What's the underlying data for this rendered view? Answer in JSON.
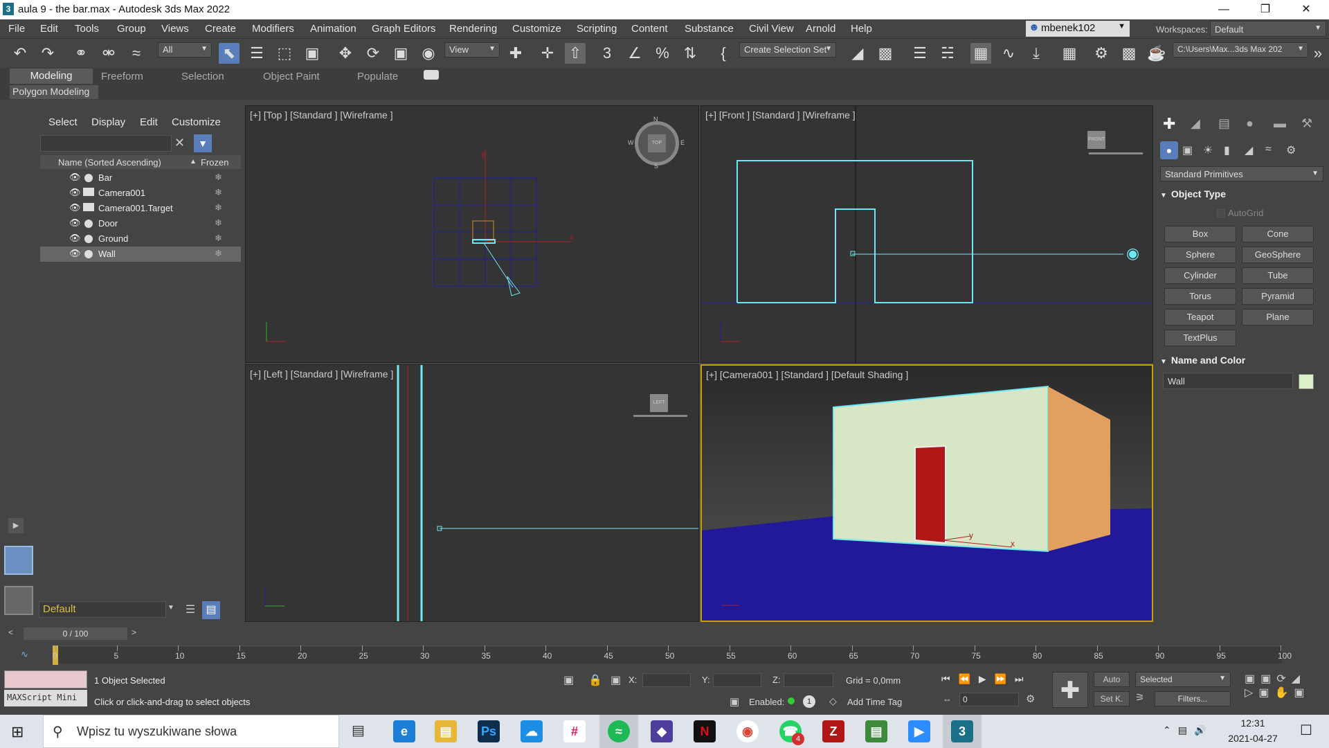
{
  "window": {
    "title": "aula 9 - the bar.max - Autodesk 3ds Max 2022",
    "app_icon": "3"
  },
  "menu": [
    "File",
    "Edit",
    "Tools",
    "Group",
    "Views",
    "Create",
    "Modifiers",
    "Animation",
    "Graph Editors",
    "Rendering",
    "Customize",
    "Scripting",
    "Content",
    "Substance",
    "Civil View",
    "Arnold",
    "Help"
  ],
  "user": "mbenek102",
  "workspace": {
    "label": "Workspaces:",
    "value": "Default"
  },
  "toolbar": {
    "filter_value": "All",
    "ref_coord_value": "View",
    "selection_set": "Create Selection Set",
    "project_path": "C:\\Users\\Max...3ds Max 202"
  },
  "ribbon": {
    "tabs": [
      "Modeling",
      "Freeform",
      "Selection",
      "Object Paint",
      "Populate"
    ],
    "panel": "Polygon Modeling"
  },
  "scene_explorer": {
    "menu": [
      "Select",
      "Display",
      "Edit",
      "Customize"
    ],
    "col_name": "Name (Sorted Ascending)",
    "col_sort": "▲",
    "col_frozen": "Frozen",
    "items": [
      {
        "name": "Bar",
        "type": "geometry"
      },
      {
        "name": "Camera001",
        "type": "camera"
      },
      {
        "name": "Camera001.Target",
        "type": "camera"
      },
      {
        "name": "Door",
        "type": "geometry"
      },
      {
        "name": "Ground",
        "type": "geometry"
      },
      {
        "name": "Wall",
        "type": "geometry",
        "selected": true
      }
    ],
    "layer": "Default"
  },
  "viewports": {
    "top": "[+] [Top ] [Standard ] [Wireframe ]",
    "front": "[+] [Front ] [Standard ] [Wireframe ]",
    "left": "[+] [Left ] [Standard ] [Wireframe ]",
    "camera": "[+] [Camera001 ] [Standard ] [Default Shading ]",
    "compass": {
      "n": "N",
      "s": "S",
      "e": "E",
      "w": "W",
      "cube": "TOP"
    },
    "front_cube": "FRONT",
    "left_cube": "LEFT",
    "axis": {
      "x": "x",
      "y": "y",
      "z": "z"
    }
  },
  "command_panel": {
    "category": "Standard Primitives",
    "object_type_title": "Object Type",
    "autogrid": "AutoGrid",
    "primitives": [
      "Box",
      "Cone",
      "Sphere",
      "GeoSphere",
      "Cylinder",
      "Tube",
      "Torus",
      "Pyramid",
      "Teapot",
      "Plane",
      "TextPlus"
    ],
    "name_color_title": "Name and Color",
    "object_name": "Wall",
    "object_color": "#d9f0c8"
  },
  "timeline": {
    "frame_display": "0 / 100",
    "ticks": [
      "0",
      "5",
      "10",
      "15",
      "20",
      "25",
      "30",
      "35",
      "40",
      "45",
      "50",
      "55",
      "60",
      "65",
      "70",
      "75",
      "80",
      "85",
      "90",
      "95",
      "100"
    ]
  },
  "status": {
    "maxscript": "MAXScript Mini",
    "selected_text": "1 Object Selected",
    "prompt": "Click or click-and-drag to select objects",
    "x_label": "X:",
    "y_label": "Y:",
    "z_label": "Z:",
    "grid": "Grid = 0,0mm",
    "enabled": "Enabled:",
    "enabled_count": "1",
    "add_time_tag": "Add Time Tag",
    "auto": "Auto",
    "set_key": "Set K.",
    "key_mode": "Selected",
    "filters": "Filters...",
    "frame": "0"
  },
  "taskbar": {
    "search_placeholder": "Wpisz tu wyszukiwane słowa",
    "time": "12:31",
    "date": "2021-04-27",
    "whatsapp_badge": "4",
    "ps_label": "Ps",
    "max_label": "3"
  },
  "colors": {
    "viewport_bg": "#343434",
    "wire_cyan": "#6fe8f5",
    "wall": "#d7e6c5",
    "wall_side": "#e2a060",
    "door": "#b01818",
    "ground": "#21199a",
    "accent_blue": "#5a7dbb"
  }
}
